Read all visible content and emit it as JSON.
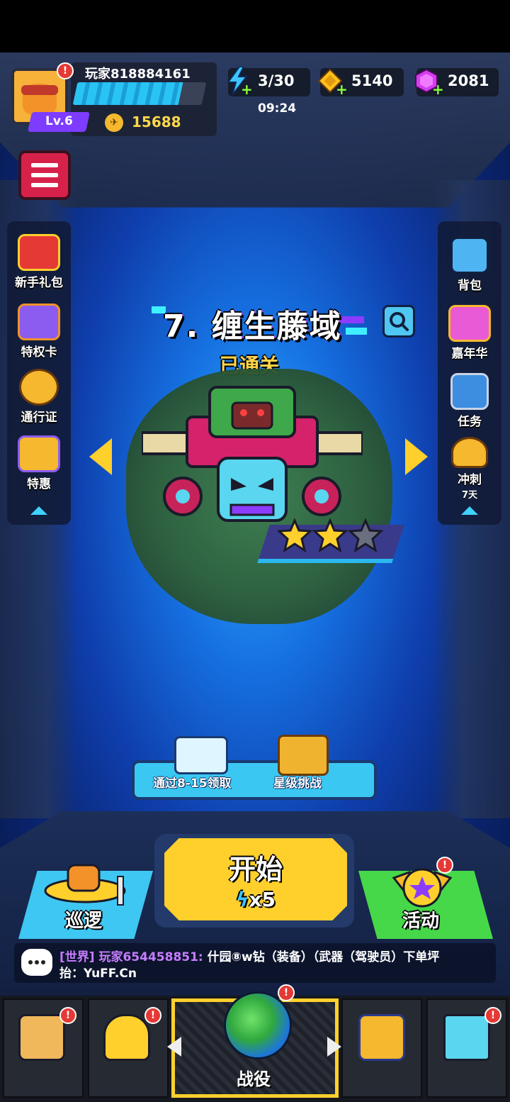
{
  "header": {
    "player_name": "玩家818884161",
    "level": "Lv.6",
    "exp_progress": 0.82,
    "rank_points": "15688",
    "energy": "3/30",
    "energy_timer": "09:24",
    "gold": "5140",
    "gems": "2081"
  },
  "left_menu": [
    {
      "label": "新手礼包",
      "icon": "gift-box-icon"
    },
    {
      "label": "特权卡",
      "icon": "privilege-card-icon"
    },
    {
      "label": "通行证",
      "icon": "battle-pass-icon"
    },
    {
      "label": "特惠",
      "icon": "special-offer-icon"
    }
  ],
  "right_menu": [
    {
      "label": "背包",
      "icon": "backpack-icon"
    },
    {
      "label": "嘉年华",
      "icon": "carnival-icon"
    },
    {
      "label": "任务",
      "icon": "quest-icon"
    },
    {
      "label": "冲刺",
      "sub": "7天",
      "icon": "sprint-trophy-icon"
    }
  ],
  "level": {
    "title": "7. 缠生藤域",
    "status": "已通关",
    "stars_earned": 2,
    "stars_total": 3
  },
  "rewards": {
    "pass_reward_label": "通过8-15领取",
    "star_challenge_label": "星级挑战"
  },
  "start": {
    "label": "开始",
    "cost": "x5"
  },
  "patrol_label": "巡逻",
  "event_label": "活动",
  "chat": {
    "channel": "[世界]",
    "sender": "玩家654458851:",
    "message": "什园⑧w钻（装备）（武器（驾驶员）下单坪",
    "line2": "抬：YuFF.Cn"
  },
  "bottom_nav": {
    "active_label": "战役"
  },
  "colors": {
    "accent_yellow": "#ffcf2c",
    "exp_blue": "#29c4f3",
    "level_purple": "#7d3cff",
    "event_green": "#47d84a",
    "alert_red": "#e53935"
  }
}
